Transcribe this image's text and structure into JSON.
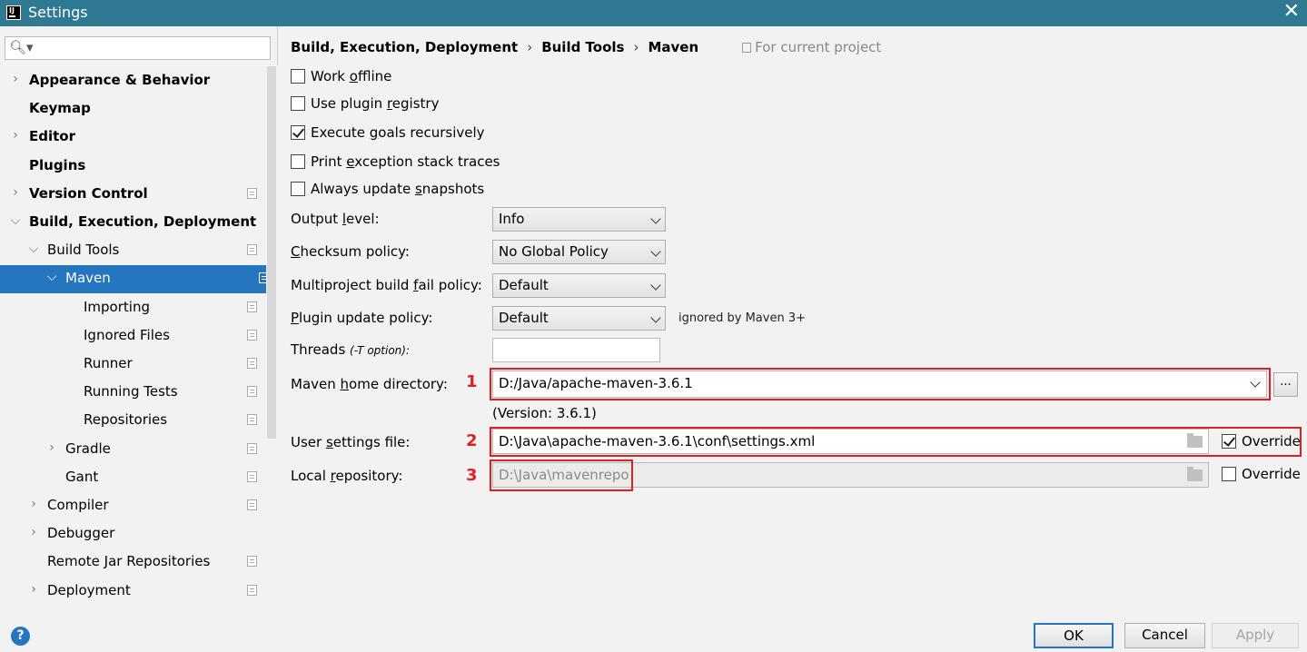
{
  "window": {
    "title": "Settings",
    "close_glyph": "✕",
    "app_icon_text": "IJ"
  },
  "search": {
    "placeholder": "",
    "icon": "search-icon"
  },
  "sidebar": {
    "items": [
      {
        "label": "Appearance & Behavior",
        "expandable": true,
        "expanded": false,
        "project_icon": false
      },
      {
        "label": "Keymap",
        "expandable": false,
        "project_icon": false
      },
      {
        "label": "Editor",
        "expandable": true,
        "expanded": false,
        "project_icon": false
      },
      {
        "label": "Plugins",
        "expandable": false,
        "project_icon": false
      },
      {
        "label": "Version Control",
        "expandable": true,
        "expanded": false,
        "project_icon": true
      },
      {
        "label": "Build, Execution, Deployment",
        "expandable": true,
        "expanded": true,
        "project_icon": false
      },
      {
        "label": "Build Tools",
        "expandable": true,
        "expanded": true,
        "project_icon": true
      },
      {
        "label": "Maven",
        "expandable": true,
        "expanded": true,
        "project_icon": true,
        "selected": true
      },
      {
        "label": "Importing",
        "expandable": false,
        "project_icon": true
      },
      {
        "label": "Ignored Files",
        "expandable": false,
        "project_icon": true
      },
      {
        "label": "Runner",
        "expandable": false,
        "project_icon": true
      },
      {
        "label": "Running Tests",
        "expandable": false,
        "project_icon": true
      },
      {
        "label": "Repositories",
        "expandable": false,
        "project_icon": true
      },
      {
        "label": "Gradle",
        "expandable": true,
        "expanded": false,
        "project_icon": true
      },
      {
        "label": "Gant",
        "expandable": false,
        "project_icon": true
      },
      {
        "label": "Compiler",
        "expandable": true,
        "expanded": false,
        "project_icon": true
      },
      {
        "label": "Debugger",
        "expandable": true,
        "expanded": false,
        "project_icon": false
      },
      {
        "label": "Remote Jar Repositories",
        "expandable": false,
        "project_icon": true
      },
      {
        "label": "Deployment",
        "expandable": true,
        "expanded": false,
        "project_icon": true
      }
    ]
  },
  "breadcrumb": {
    "parts": [
      "Build, Execution, Deployment",
      "Build Tools",
      "Maven"
    ],
    "separator": "›",
    "scope": "For current project"
  },
  "options": {
    "work_offline": {
      "pre": "Work ",
      "u": "o",
      "post": "ffline",
      "checked": false
    },
    "use_plugin_registry": {
      "pre": "Use plugin ",
      "u": "r",
      "post": "egistry",
      "checked": false
    },
    "execute_goals": {
      "pre": "Execute ",
      "u": "g",
      "post": "oals recursively",
      "checked": true
    },
    "print_exception": {
      "pre": "Print ",
      "u": "e",
      "post": "xception stack traces",
      "checked": false
    },
    "always_update": {
      "pre": "Always update ",
      "u": "s",
      "post": "napshots",
      "checked": false
    }
  },
  "form": {
    "output_level": {
      "pre": "Output ",
      "u": "l",
      "post": "evel:",
      "value": "Info"
    },
    "checksum_policy": {
      "pre": "",
      "u": "C",
      "post": "hecksum policy:",
      "value": "No Global Policy"
    },
    "multiproject": {
      "pre": "Multiproject build ",
      "u": "f",
      "post": "ail policy:",
      "value": "Default"
    },
    "plugin_update": {
      "pre": "",
      "u": "P",
      "post": "lugin update policy:",
      "value": "Default",
      "note": "ignored by Maven 3+"
    },
    "threads": {
      "label": "Threads",
      "hint": "(-T option):",
      "value": ""
    },
    "maven_home": {
      "pre": "Maven ",
      "u": "h",
      "post": "ome directory:",
      "value": "D:/Java/apache-maven-3.6.1",
      "version": "(Version: 3.6.1)",
      "browse": "..."
    },
    "user_settings": {
      "pre": "User ",
      "u": "s",
      "post": "ettings file:",
      "value": "D:\\Java\\apache-maven-3.6.1\\conf\\settings.xml",
      "override_label": "Override",
      "override_checked": true
    },
    "local_repo": {
      "pre": "Local ",
      "u": "r",
      "post": "epository:",
      "value": "D:\\Java\\mavenrepo",
      "override_label": "Override",
      "override_checked": false
    }
  },
  "annotations": [
    "1",
    "2",
    "3"
  ],
  "footer": {
    "ok": "OK",
    "cancel": "Cancel",
    "apply": "Apply",
    "help": "?"
  },
  "colors": {
    "titlebar": "#2f7a92",
    "selection": "#2675bf",
    "annotation": "#e02020"
  }
}
